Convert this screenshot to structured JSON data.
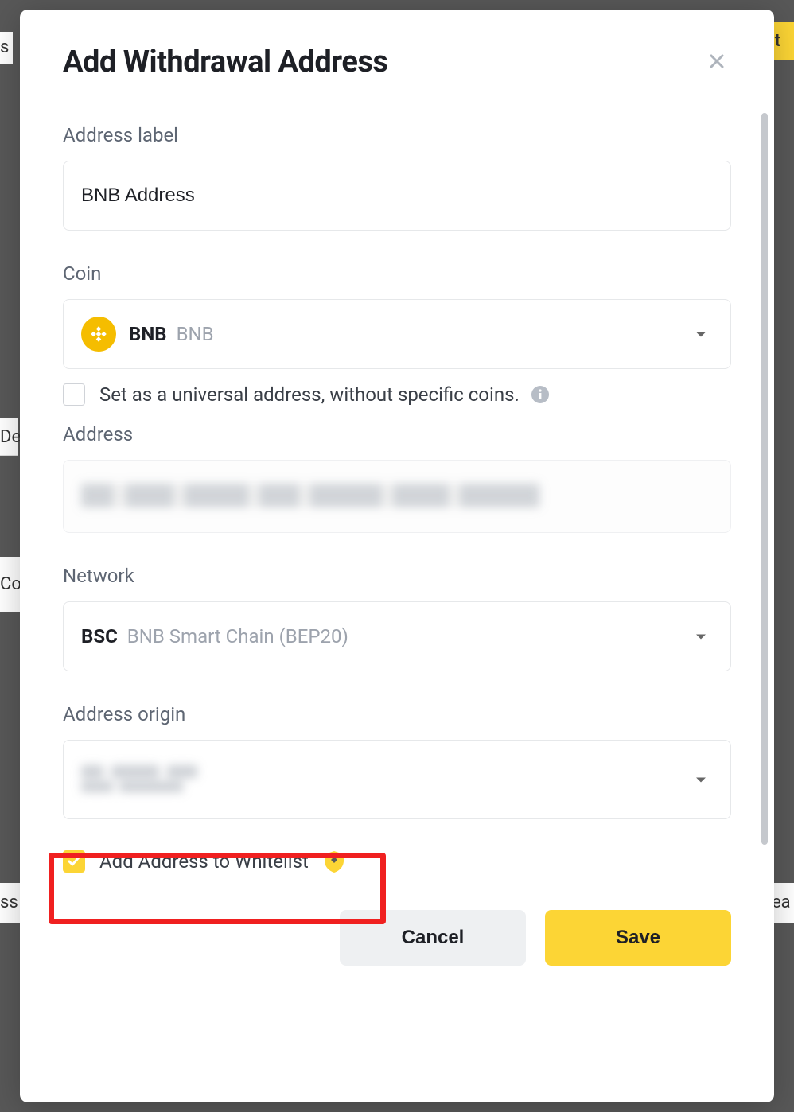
{
  "modal": {
    "title": "Add Withdrawal Address",
    "fields": {
      "address_label": {
        "label": "Address label",
        "value": "BNB Address"
      },
      "coin": {
        "label": "Coin",
        "symbol": "BNB",
        "name": "BNB"
      },
      "universal_checkbox": {
        "checked": false,
        "label": "Set as a universal address, without specific coins."
      },
      "address": {
        "label": "Address"
      },
      "network": {
        "label": "Network",
        "symbol": "BSC",
        "name": "BNB Smart Chain (BEP20)"
      },
      "address_origin": {
        "label": "Address origin"
      },
      "whitelist_checkbox": {
        "checked": true,
        "label": "Add Address to Whitelist"
      }
    },
    "buttons": {
      "cancel": "Cancel",
      "save": "Save"
    }
  }
}
